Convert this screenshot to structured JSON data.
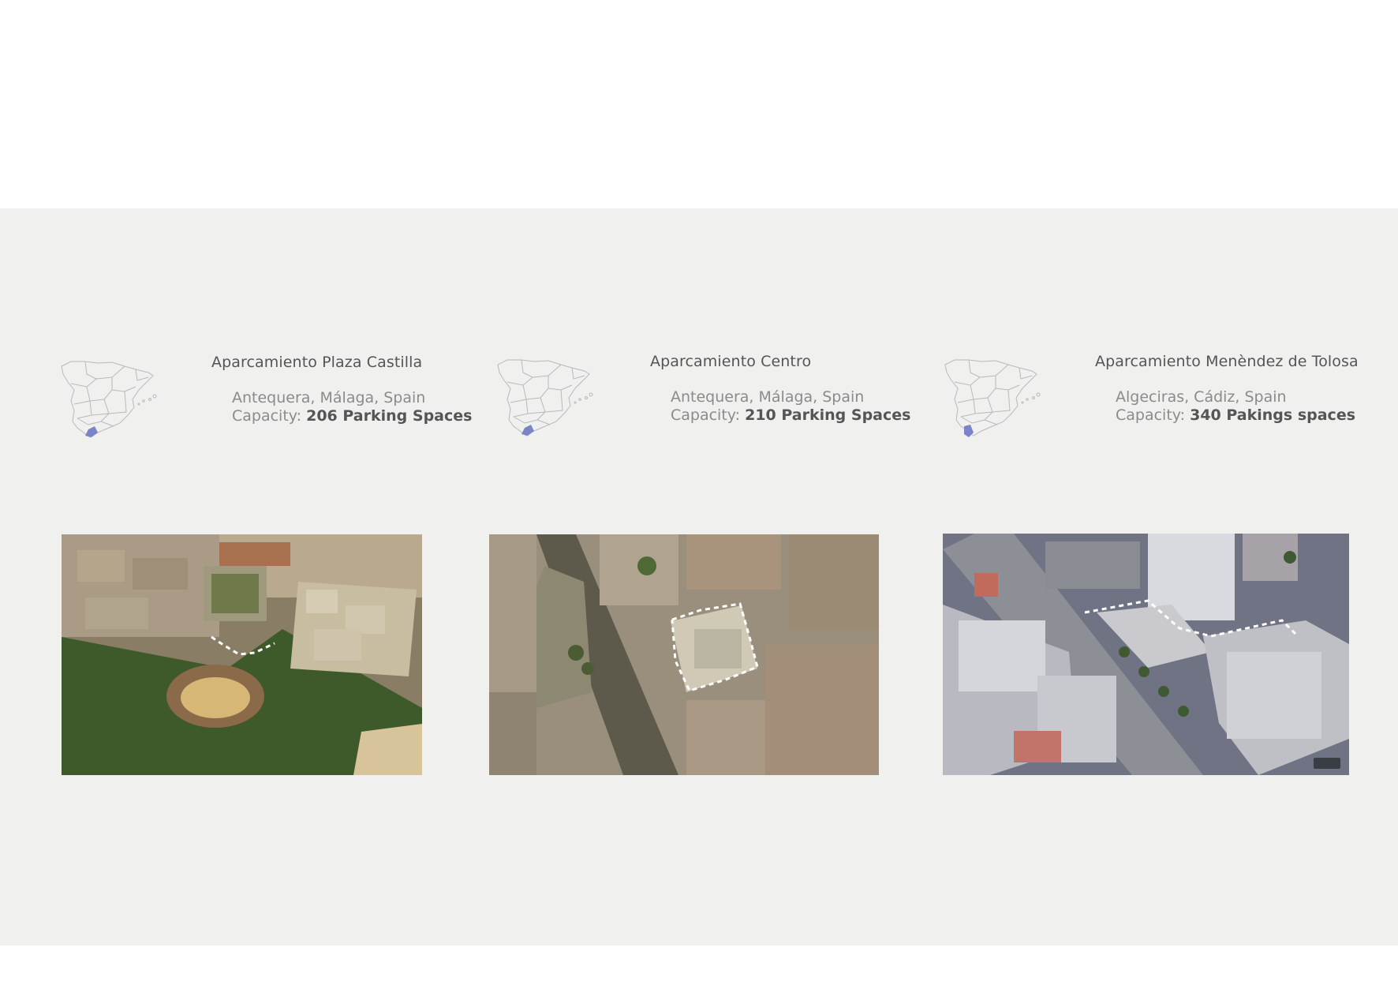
{
  "locations": [
    {
      "name": "Aparcamiento Plaza Castilla",
      "place": "Antequera, Málaga, Spain",
      "capacity_prefix": "Capacity:",
      "capacity_value": "206 Parking Spaces",
      "highlight_region": "Málaga",
      "photo_label": "aerial view with bullring"
    },
    {
      "name": "Aparcamiento Centro",
      "place": "Antequera, Málaga, Spain",
      "capacity_prefix": "Capacity:",
      "capacity_value": "210 Parking Spaces",
      "highlight_region": "Málaga",
      "photo_label": "aerial view of old town"
    },
    {
      "name": "Aparcamiento Menèndez de Tolosa",
      "place": "Algeciras, Cádiz, Spain",
      "capacity_prefix": "Capacity:",
      "capacity_value": "340 Pakings spaces",
      "highlight_region": "Cádiz",
      "photo_label": "3D aerial view of city block"
    }
  ],
  "colors": {
    "band": "#f0f0ef",
    "map_outline": "#b9b9bd",
    "map_highlight": "#7b84c9",
    "parking_outline": "#ffffff"
  }
}
